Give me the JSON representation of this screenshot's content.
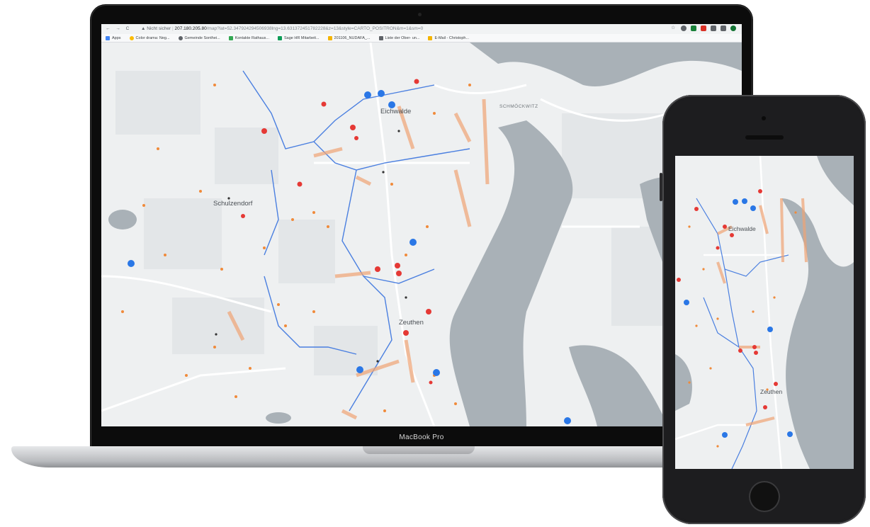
{
  "browser": {
    "nav_icons": "← → C",
    "security_label": "Nicht sicher",
    "url_host": "207.180.205.80",
    "url_path": "/map?lat=52.347924294506938lng=13.631372451782228&z=13&style=CARTO_POSITRON&m=1&sm=0"
  },
  "bookmarks": [
    {
      "label": "Apps",
      "color": "#4285f4"
    },
    {
      "label": "Color drama: Neg...",
      "color": "#fbbc05"
    },
    {
      "label": "Gemeinde Sonthei...",
      "color": "#5f6368"
    },
    {
      "label": "Kontakte Rathaus...",
      "color": "#34a853"
    },
    {
      "label": "Sage HR Mitarbeit...",
      "color": "#0f9d58"
    },
    {
      "label": "201106_NUDAFA_...",
      "color": "#f4b400"
    },
    {
      "label": "Liste der Ober- un...",
      "color": "#5f6368"
    },
    {
      "label": "E-Mail - Christoph...",
      "color": "#f4b400"
    }
  ],
  "map_labels": {
    "eichwalde": "Eichwalde",
    "schulzendorf": "Schulzendorf",
    "zeuthen": "Zeuthen",
    "schmockwitz": "SCHMÖCKWITZ"
  },
  "laptop_brand": "MacBook Pro",
  "colors": {
    "water": "#a9b1b7",
    "land": "#eef0f1",
    "route_blue": "#4a7fe0",
    "route_orange": "#f0a274",
    "marker_red": "#e53935",
    "marker_blue": "#2a77e6",
    "dot_orange": "#f08a3a"
  }
}
